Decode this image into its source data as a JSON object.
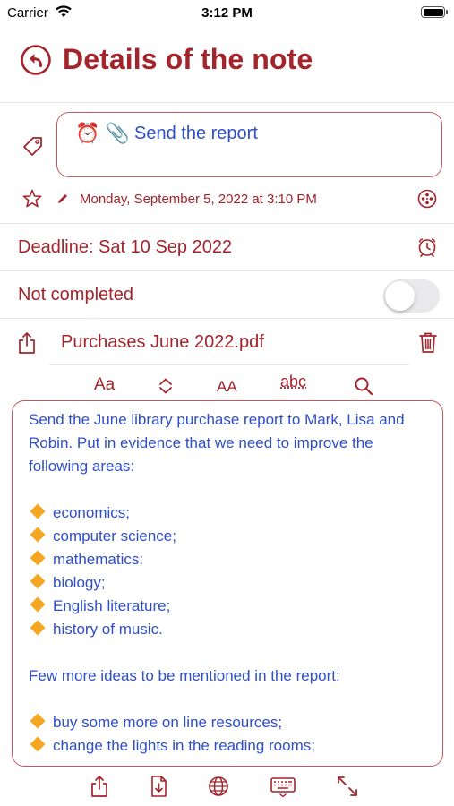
{
  "status_bar": {
    "carrier": "Carrier",
    "time": "3:12 PM"
  },
  "header": {
    "title": "Details of the note"
  },
  "note": {
    "title_glyphs": "⏰ 📎",
    "title": "Send the report",
    "date": "Monday, September 5, 2022 at 3:10 PM"
  },
  "deadline": {
    "label": "Deadline: Sat 10 Sep 2022"
  },
  "completion": {
    "label": "Not completed",
    "on": false
  },
  "attachment": {
    "file_name": "Purchases June 2022.pdf"
  },
  "format_bar": {
    "font": "Aa",
    "spacing": "⌃⌄",
    "size": "AA",
    "spell": "abc",
    "search": "search-icon"
  },
  "body": {
    "intro": "Send the June library purchase report to Mark, Lisa and Robin. Put in evidence that we need to improve the following areas:",
    "areas": [
      "economics;",
      "computer science;",
      "mathematics:",
      "biology;",
      "English literature;",
      "history of music."
    ],
    "ideas_intro": "Few more ideas to be mentioned in the report:",
    "ideas": [
      "buy some more on line resources;",
      "change the lights in the reading rooms;"
    ]
  },
  "icons": [
    "back-arrow-icon",
    "tag-icon",
    "star-icon",
    "pencil-icon",
    "film-reel-icon",
    "alarm-clock-icon",
    "share-icon",
    "trash-icon",
    "search-icon",
    "download-icon",
    "globe-icon",
    "keyboard-icon",
    "expand-icon"
  ],
  "colors": {
    "accent": "#a3242b",
    "text_blue": "#2f4fc7",
    "bullet": "#f5a623"
  }
}
